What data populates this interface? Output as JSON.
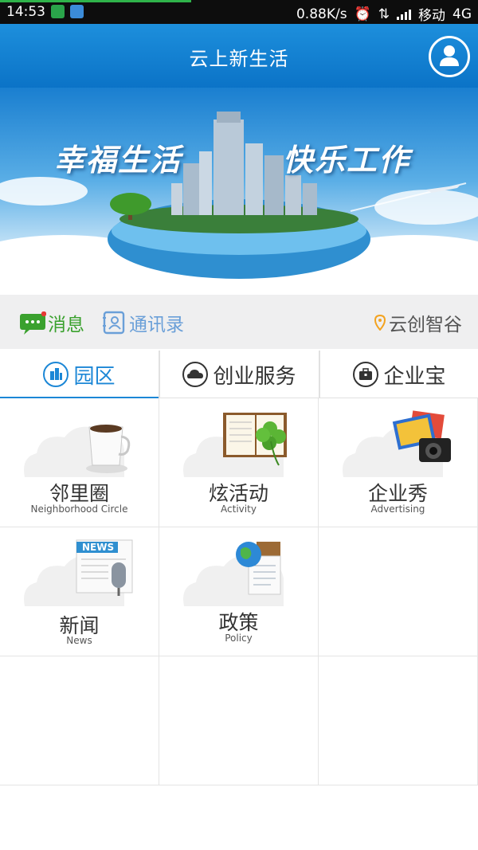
{
  "status_bar": {
    "time": "14:53",
    "network_speed": "0.88K/s",
    "carrier": "移动",
    "network_type": "4G",
    "icons": [
      "shield-icon",
      "cloud-app-icon",
      "alarm-icon",
      "data-transfer-icon",
      "signal-icon"
    ]
  },
  "header": {
    "title": "云上新生活",
    "profile_icon": "user-icon",
    "colors": {
      "bar": "#1683d4"
    }
  },
  "banner": {
    "slogan_left": "幸福生活",
    "slogan_right": "快乐工作"
  },
  "message_bar": {
    "messages_label": "消息",
    "contacts_label": "通讯录",
    "location_label": "云创智谷",
    "colors": {
      "messages": "#3aa12e",
      "contacts": "#6a9fd8",
      "location_pin": "#f3a320"
    }
  },
  "tabs": [
    {
      "label": "园区",
      "icon": "buildings-icon",
      "active": true
    },
    {
      "label": "创业服务",
      "icon": "cloud-icon",
      "active": false
    },
    {
      "label": "企业宝",
      "icon": "briefcase-icon",
      "active": false
    }
  ],
  "grid": [
    {
      "label": "邻里圈",
      "sub": "Neighborhood Circle",
      "icon": "coffee-cup-icon"
    },
    {
      "label": "炫活动",
      "sub": "Activity",
      "icon": "book-clover-icon"
    },
    {
      "label": "企业秀",
      "sub": "Advertising",
      "icon": "camera-photos-icon"
    },
    {
      "label": "新闻",
      "sub": "News",
      "icon": "news-microphone-icon",
      "badge": "NEWS"
    },
    {
      "label": "政策",
      "sub": "Policy",
      "icon": "globe-document-icon"
    }
  ],
  "accent_color": "#1c87d6"
}
